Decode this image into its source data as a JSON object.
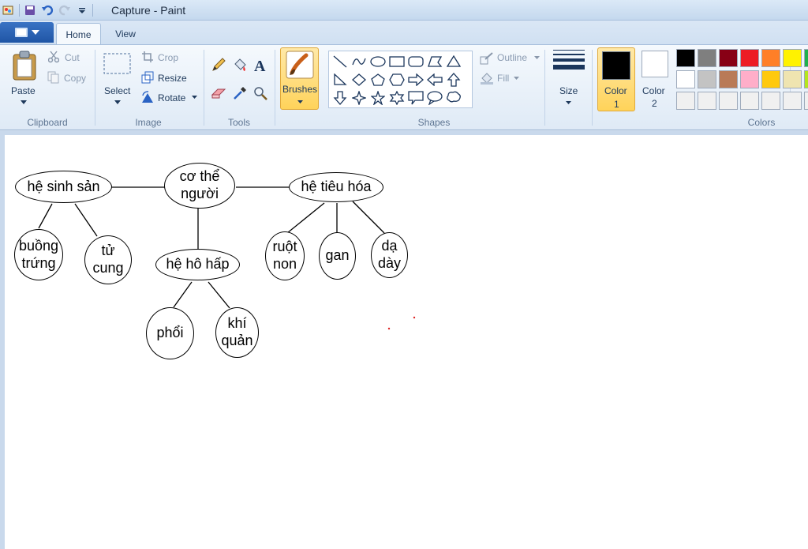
{
  "window": {
    "title": "Capture - Paint"
  },
  "tabs": {
    "home": "Home",
    "view": "View"
  },
  "clipboard": {
    "paste": "Paste",
    "cut": "Cut",
    "copy": "Copy",
    "label": "Clipboard"
  },
  "image": {
    "select": "Select",
    "crop": "Crop",
    "resize": "Resize",
    "rotate": "Rotate",
    "label": "Image"
  },
  "tools": {
    "label": "Tools"
  },
  "brushes": {
    "label": "Brushes"
  },
  "shapes": {
    "outline": "Outline",
    "fill": "Fill",
    "label": "Shapes"
  },
  "size": {
    "label": "Size"
  },
  "colors": {
    "color1": "Color\n1",
    "color1_line1": "Color",
    "color1_line2": "1",
    "color2_line1": "Color",
    "color2_line2": "2",
    "label": "Colors",
    "color1_value": "#000000",
    "color2_value": "#ffffff",
    "palette_row1": [
      "#000000",
      "#7f7f7f",
      "#880015",
      "#ed1c24",
      "#ff7f27",
      "#fff200",
      "#22b14c"
    ],
    "palette_row2": [
      "#ffffff",
      "#c3c3c3",
      "#b97a57",
      "#ffaec9",
      "#ffc90e",
      "#efe4b0",
      "#b5e61d"
    ],
    "palette_row3": [
      "#f0f0f0",
      "#f0f0f0",
      "#f0f0f0",
      "#f0f0f0",
      "#f0f0f0",
      "#f0f0f0",
      "#f0f0f0"
    ]
  },
  "diagram": {
    "center": {
      "line1": "cơ thể",
      "line2": "người"
    },
    "reproductive": "hệ sinh sản",
    "digestive": "hệ tiêu hóa",
    "respiratory": "hệ hô hấp",
    "ovary": {
      "line1": "buồng",
      "line2": "trứng"
    },
    "uterus": {
      "line1": "tử",
      "line2": "cung"
    },
    "small_intestine": {
      "line1": "ruột",
      "line2": "non"
    },
    "liver": "gan",
    "stomach": {
      "line1": "dạ",
      "line2": "dày"
    },
    "lungs": "phổi",
    "trachea": {
      "line1": "khí",
      "line2": "quản"
    }
  }
}
